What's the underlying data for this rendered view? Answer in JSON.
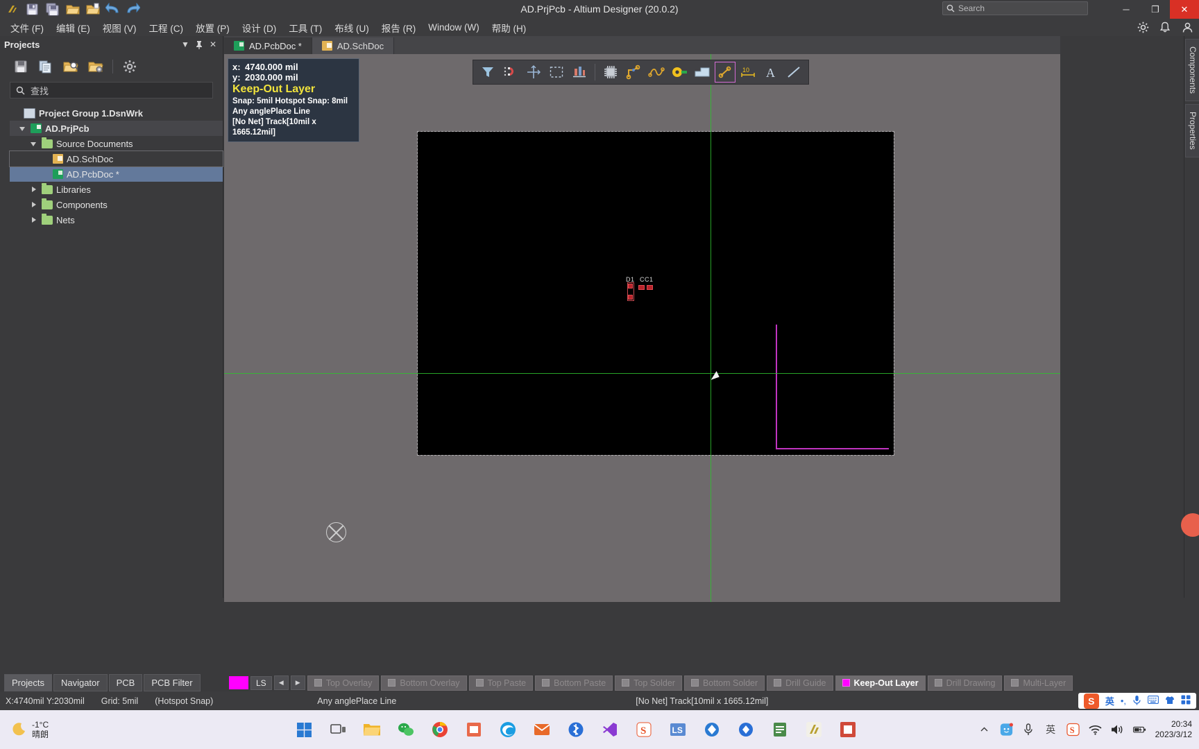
{
  "window": {
    "title": "AD.PrjPcb - Altium Designer (20.0.2)",
    "search_placeholder": "Search",
    "minimize": "─",
    "maximize": "❐",
    "close": "✕"
  },
  "quick_access": [
    {
      "name": "altium-logo-icon",
      "glyph": "A"
    },
    {
      "name": "save-icon",
      "glyph": "💾"
    },
    {
      "name": "save-all-icon",
      "glyph": "💾"
    },
    {
      "name": "open-icon",
      "glyph": "📁"
    },
    {
      "name": "open-project-icon",
      "glyph": "📂"
    },
    {
      "name": "undo-icon",
      "glyph": "↶"
    },
    {
      "name": "redo-icon",
      "glyph": "↷"
    }
  ],
  "menu": {
    "items": [
      {
        "label": "文件 (F)",
        "name": "menu-file"
      },
      {
        "label": "编辑 (E)",
        "name": "menu-edit"
      },
      {
        "label": "视图 (V)",
        "name": "menu-view"
      },
      {
        "label": "工程 (C)",
        "name": "menu-project"
      },
      {
        "label": "放置 (P)",
        "name": "menu-place"
      },
      {
        "label": "设计 (D)",
        "name": "menu-design"
      },
      {
        "label": "工具 (T)",
        "name": "menu-tools"
      },
      {
        "label": "布线 (U)",
        "name": "menu-route"
      },
      {
        "label": "报告 (R)",
        "name": "menu-reports"
      },
      {
        "label": "Window (W)",
        "name": "menu-window"
      },
      {
        "label": "帮助 (H)",
        "name": "menu-help"
      }
    ],
    "right_icons": [
      {
        "name": "settings-gear-icon",
        "glyph": "⚙"
      },
      {
        "name": "notifications-bell-icon",
        "glyph": "🔔"
      },
      {
        "name": "user-account-icon",
        "glyph": "👤"
      }
    ]
  },
  "projects_panel": {
    "title": "Projects",
    "header_icons": [
      {
        "name": "panel-dropdown-icon",
        "glyph": "▼"
      },
      {
        "name": "panel-pin-icon",
        "glyph": "📌"
      },
      {
        "name": "panel-close-icon",
        "glyph": "✕"
      }
    ],
    "toolbar_icons": [
      {
        "name": "save-project-icon",
        "glyph": "💾"
      },
      {
        "name": "compile-document-icon",
        "glyph": "📄"
      },
      {
        "name": "open-project-search-icon",
        "glyph": "📁"
      },
      {
        "name": "project-options-folder-icon",
        "glyph": "📁"
      },
      {
        "name": "panel-settings-gear-icon",
        "glyph": "⚙"
      }
    ],
    "search_placeholder": "查找",
    "tree": [
      {
        "label": "Project Group 1.DsnWrk",
        "icon": "workspace-group-icon",
        "indent": 0,
        "state": "none",
        "style": "bold"
      },
      {
        "label": "AD.PrjPcb",
        "icon": "pcb-project-icon",
        "indent": 1,
        "state": "expanded",
        "style": "bold-highlight"
      },
      {
        "label": "Source Documents",
        "icon": "folder-icon",
        "indent": 2,
        "state": "expanded",
        "style": "normal"
      },
      {
        "label": "AD.SchDoc",
        "icon": "schematic-doc-icon",
        "indent": 3,
        "state": "none",
        "style": "outline"
      },
      {
        "label": "AD.PcbDoc *",
        "icon": "pcb-doc-icon",
        "indent": 3,
        "state": "none",
        "style": "selected"
      },
      {
        "label": "Libraries",
        "icon": "folder-icon",
        "indent": 2,
        "state": "collapsed",
        "style": "normal"
      },
      {
        "label": "Components",
        "icon": "folder-icon",
        "indent": 2,
        "state": "collapsed",
        "style": "normal"
      },
      {
        "label": "Nets",
        "icon": "folder-icon",
        "indent": 2,
        "state": "collapsed",
        "style": "normal"
      }
    ],
    "bottom_tabs": [
      {
        "label": "Projects",
        "active": true
      },
      {
        "label": "Navigator",
        "active": false
      },
      {
        "label": "PCB",
        "active": false
      },
      {
        "label": "PCB Filter",
        "active": false
      }
    ]
  },
  "document_tabs": [
    {
      "label": "AD.PcbDoc *",
      "icon": "pcb-doc-icon",
      "active": true
    },
    {
      "label": "AD.SchDoc",
      "icon": "schematic-doc-icon",
      "active": false
    }
  ],
  "right_dock_tabs": [
    {
      "label": "Components",
      "name": "dock-tab-components"
    },
    {
      "label": "Properties",
      "name": "dock-tab-properties"
    }
  ],
  "pcb_toolbar": [
    {
      "name": "filter-icon",
      "glyph": "▼",
      "boxed": false
    },
    {
      "name": "snap-magnet-icon",
      "glyph": "U",
      "boxed": false
    },
    {
      "name": "crosshair-icon",
      "glyph": "✛",
      "boxed": false
    },
    {
      "name": "selection-box-icon",
      "glyph": "⬚",
      "boxed": false
    },
    {
      "name": "align-icon",
      "glyph": "█",
      "boxed": false
    },
    {
      "separator": true
    },
    {
      "name": "place-component-icon",
      "glyph": "▦",
      "boxed": false
    },
    {
      "name": "interactive-routing-icon",
      "glyph": "↗",
      "boxed": false
    },
    {
      "name": "differential-pair-routing-icon",
      "glyph": "∿",
      "boxed": false
    },
    {
      "name": "place-via-icon",
      "glyph": "◉",
      "boxed": false
    },
    {
      "name": "place-polygon-icon",
      "glyph": "▰",
      "boxed": false
    },
    {
      "name": "place-line-icon",
      "glyph": "↗",
      "boxed": true
    },
    {
      "name": "place-dimension-icon",
      "glyph": "10",
      "boxed": false
    },
    {
      "name": "place-string-icon",
      "glyph": "A",
      "boxed": false
    },
    {
      "name": "place-track-icon",
      "glyph": "╱",
      "boxed": false
    }
  ],
  "tooltip": {
    "x_key": "x:",
    "x_value": "4740.000 mil",
    "y_key": "y:",
    "y_value": "2030.000 mil",
    "layer": "Keep-Out Layer",
    "snap": "Snap: 5mil Hotspot Snap: 8mil",
    "mode": "Any anglePlace Line",
    "net": "[No Net] Track[10mil x 1665.12mil]"
  },
  "canvas": {
    "components": [
      {
        "label": "D1",
        "name": "component-d1"
      },
      {
        "label": "CC1",
        "name": "component-cc1"
      }
    ]
  },
  "layer_bar": {
    "color_chip": "#ff00ff",
    "ls_button": "LS",
    "prev": "◀",
    "next": "▶",
    "layers": [
      {
        "label": "Top Overlay",
        "active": false,
        "color": "#8a878a"
      },
      {
        "label": "Bottom Overlay",
        "active": false,
        "color": "#8a878a"
      },
      {
        "label": "Top Paste",
        "active": false,
        "color": "#8a878a"
      },
      {
        "label": "Bottom Paste",
        "active": false,
        "color": "#8a878a"
      },
      {
        "label": "Top Solder",
        "active": false,
        "color": "#8a878a"
      },
      {
        "label": "Bottom Solder",
        "active": false,
        "color": "#8a878a"
      },
      {
        "label": "Drill Guide",
        "active": false,
        "color": "#8a878a"
      },
      {
        "label": "Keep-Out Layer",
        "active": true,
        "color": "#ff00ff"
      },
      {
        "label": "Drill Drawing",
        "active": false,
        "color": "#8a878a"
      },
      {
        "label": "Multi-Layer",
        "active": false,
        "color": "#8a878a"
      }
    ]
  },
  "status_bar": {
    "coords": "X:4740mil Y:2030mil",
    "grid": "Grid: 5mil",
    "snap": "(Hotspot Snap)",
    "mode": "Any anglePlace Line",
    "net": "[No Net] Track[10mil x 1665.12mil]",
    "ime": [
      {
        "name": "sogou-ime-icon",
        "glyph": "S"
      },
      {
        "name": "ime-language-icon",
        "glyph": "英"
      },
      {
        "name": "ime-punctuation-icon",
        "glyph": "•,"
      },
      {
        "name": "ime-voice-icon",
        "glyph": "🎤"
      },
      {
        "name": "ime-keyboard-icon",
        "glyph": "⌨"
      },
      {
        "name": "ime-skin-icon",
        "glyph": "👕"
      },
      {
        "name": "ime-toolbox-icon",
        "glyph": "▒"
      }
    ]
  },
  "taskbar": {
    "weather_temp": "-1°C",
    "weather_desc": "晴朗",
    "apps": [
      {
        "name": "start-button-icon",
        "glyph": "⊞",
        "color": "#2a7ad2"
      },
      {
        "name": "task-view-icon",
        "glyph": "▣",
        "color": "#4a4a4a"
      },
      {
        "name": "file-explorer-icon",
        "glyph": "📁",
        "color": "#f0b429"
      },
      {
        "name": "wechat-icon",
        "glyph": "✉",
        "color": "#2aa84a"
      },
      {
        "name": "chrome-icon",
        "glyph": "◉",
        "color": "#4285f4"
      },
      {
        "name": "store-icon",
        "glyph": "▤",
        "color": "#e8694a"
      },
      {
        "name": "edge-icon",
        "glyph": "e",
        "color": "#1b9de2"
      },
      {
        "name": "foxmail-icon",
        "glyph": "✉",
        "color": "#e86a2a"
      },
      {
        "name": "bluetooth-icon",
        "glyph": "⬡",
        "color": "#2a6fd6"
      },
      {
        "name": "visual-studio-icon",
        "glyph": "∞",
        "color": "#8a3ad2"
      },
      {
        "name": "sogou-input-icon",
        "glyph": "S",
        "color": "#e8542a"
      },
      {
        "name": "ls-app-icon",
        "glyph": "LS",
        "color": "#5a8ad2"
      },
      {
        "name": "keil-icon",
        "glyph": "◈",
        "color": "#2a7ad2"
      },
      {
        "name": "diamond-app-icon",
        "glyph": "◆",
        "color": "#2a6fd6"
      },
      {
        "name": "pdf-reader-icon",
        "glyph": "▧",
        "color": "#4a8a4a"
      },
      {
        "name": "altium-designer-icon",
        "glyph": "A",
        "color": "#b8a030"
      },
      {
        "name": "media-player-icon",
        "glyph": "■",
        "color": "#d04a3a"
      }
    ],
    "tray": [
      {
        "name": "tray-overflow-icon",
        "glyph": "˄"
      },
      {
        "name": "tray-chat-icon",
        "glyph": "◑"
      },
      {
        "name": "tray-mic-icon",
        "glyph": "🎤"
      },
      {
        "name": "tray-ime-icon",
        "glyph": "英"
      },
      {
        "name": "tray-sogou-icon",
        "glyph": "S"
      },
      {
        "name": "wifi-icon",
        "glyph": "◠"
      },
      {
        "name": "volume-icon",
        "glyph": "🔊"
      },
      {
        "name": "battery-icon",
        "glyph": "▭"
      }
    ],
    "time": "20:34",
    "date": "2023/3/12"
  }
}
